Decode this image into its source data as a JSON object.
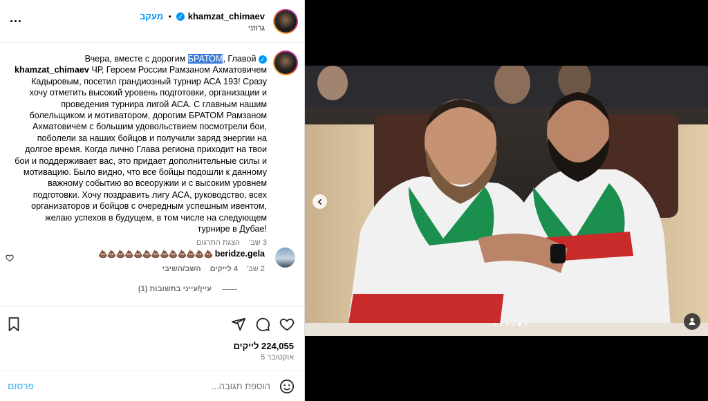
{
  "header": {
    "username": "khamzat_chimaev",
    "follow_label": "מעקב",
    "separator": "•",
    "location": "גרוזני",
    "more_label": "..."
  },
  "caption": {
    "username": "khamzat_chimaev",
    "before": "Вчера, вместе с дорогим",
    "highlight": "БРАТОМ",
    "after_highlight": ", Главой",
    "body": "ЧР, Героем России Рамзаном Ахматовичем Кадыровым, посетил грандиозный турнир АСА 193! Сразу хочу отметить высокий уровень подготовки, организации и проведения турнира лигой АСА. С главным нашим болельщиком и мотиватором, дорогим БРАТОМ Рамзаном Ахматовичем с большим удовольствием посмотрели бои, поболели за наших бойцов и получили заряд энергии на долгое время. Когда лично Глава региона приходит на твои бои и поддерживает вас, это придает дополнительные силы и мотивацию. Было видно, что все бойцы подошли к данному важному событию во всеоружии и с высоким уровнем подготовки. Хочу поздравить лигу АСА, руководство, всех организаторов и бойцов с очередным успешным ивентом, желаю успехов в будущем, в том числе на следующем турнире в Дубае!",
    "time": "3 שב'",
    "translate": "הצגת התרגום"
  },
  "comment": {
    "username": "beridze.gela",
    "text": "💩💩💩💩💩💩💩💩💩💩💩💩💩",
    "time": "2 שב'",
    "likes": "4 לייקים",
    "reply": "השב/השיבי",
    "view_replies": "עיין/עייני בתשובות (1)"
  },
  "stats": {
    "likes": "224,055 לייקים",
    "date": "5 אוקטובר"
  },
  "add_comment": {
    "placeholder": "הוספת תגובה...",
    "post": "פרסום"
  },
  "icons": {
    "like": "heart-icon",
    "comment": "comment-icon",
    "share": "share-icon",
    "save": "bookmark-icon",
    "emoji": "emoji-icon"
  },
  "carousel": {
    "dots": 6,
    "active": 4
  },
  "colors": {
    "accent": "#0095f6",
    "highlight": "#3b7dd8",
    "jacket_green": "#1a8f4e",
    "jacket_red": "#c92a2a"
  }
}
